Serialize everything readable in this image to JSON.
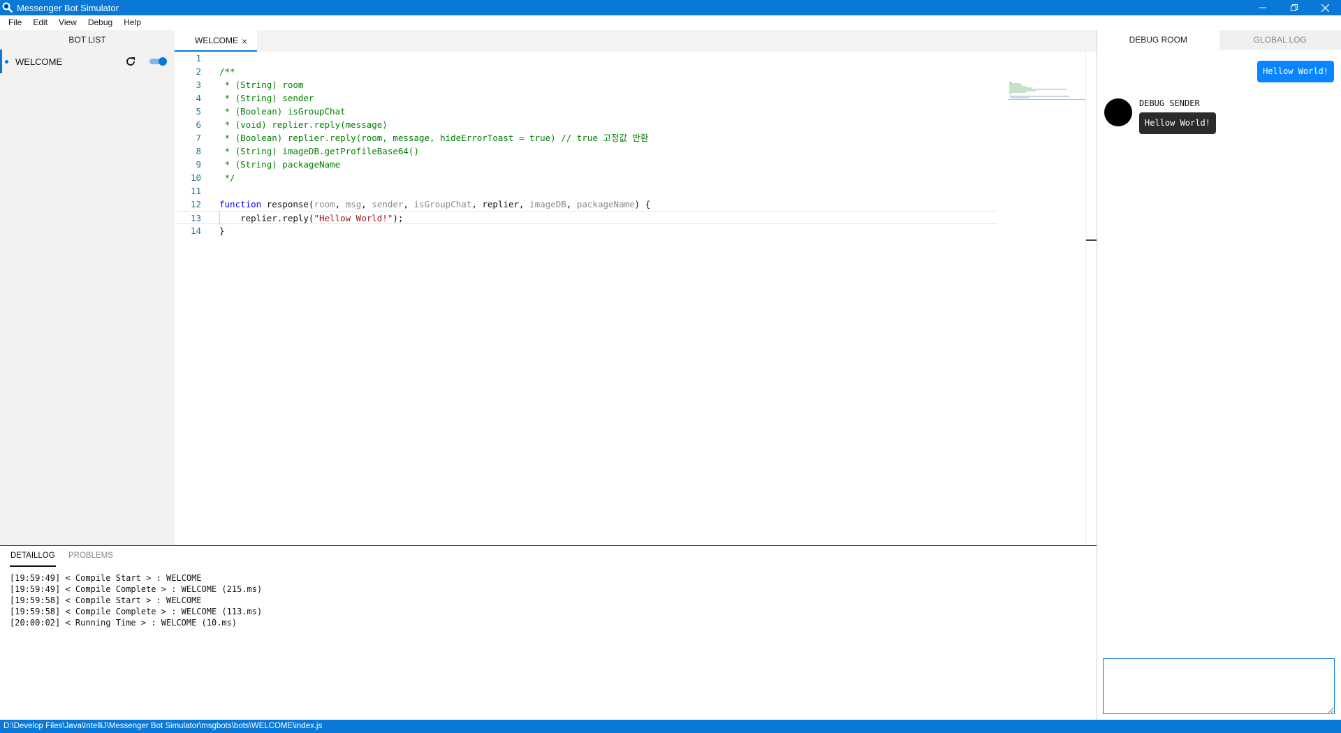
{
  "window": {
    "title": "Messenger Bot Simulator",
    "controls": [
      "minimize",
      "restore",
      "close"
    ]
  },
  "menu": [
    "File",
    "Edit",
    "View",
    "Debug",
    "Help"
  ],
  "sidebar": {
    "header": "BOT LIST",
    "bots": [
      {
        "name": "WELCOME",
        "enabled": true
      }
    ]
  },
  "editor": {
    "tab": {
      "label": "WELCOME",
      "close": "×"
    },
    "lines": [
      {
        "n": "1",
        "parts": []
      },
      {
        "n": "2",
        "parts": [
          {
            "t": "/**",
            "c": "comment"
          }
        ]
      },
      {
        "n": "3",
        "parts": [
          {
            "t": " * (String) room",
            "c": "comment"
          }
        ]
      },
      {
        "n": "4",
        "parts": [
          {
            "t": " * (String) sender",
            "c": "comment"
          }
        ]
      },
      {
        "n": "5",
        "parts": [
          {
            "t": " * (Boolean) isGroupChat",
            "c": "comment"
          }
        ]
      },
      {
        "n": "6",
        "parts": [
          {
            "t": " * (void) replier.reply(message)",
            "c": "comment"
          }
        ]
      },
      {
        "n": "7",
        "parts": [
          {
            "t": " * (Boolean) replier.reply(room, message, hideErrorToast = true) // true 고정값 반환",
            "c": "comment"
          }
        ]
      },
      {
        "n": "8",
        "parts": [
          {
            "t": " * (String) imageDB.getProfileBase64()",
            "c": "comment"
          }
        ]
      },
      {
        "n": "9",
        "parts": [
          {
            "t": " * (String) packageName",
            "c": "comment"
          }
        ]
      },
      {
        "n": "10",
        "parts": [
          {
            "t": " */",
            "c": "comment"
          }
        ]
      },
      {
        "n": "11",
        "parts": []
      },
      {
        "n": "12",
        "parts": [
          {
            "t": "function",
            "c": "kw"
          },
          {
            "t": " response(",
            "c": "plain"
          },
          {
            "t": "room",
            "c": "param"
          },
          {
            "t": ", ",
            "c": "plain"
          },
          {
            "t": "msg",
            "c": "param"
          },
          {
            "t": ", ",
            "c": "plain"
          },
          {
            "t": "sender",
            "c": "param"
          },
          {
            "t": ", ",
            "c": "plain"
          },
          {
            "t": "isGroupChat",
            "c": "param"
          },
          {
            "t": ", replier, ",
            "c": "plain"
          },
          {
            "t": "imageDB",
            "c": "param"
          },
          {
            "t": ", ",
            "c": "plain"
          },
          {
            "t": "packageName",
            "c": "param"
          },
          {
            "t": ") {",
            "c": "plain"
          }
        ]
      },
      {
        "n": "13",
        "current": true,
        "parts": [
          {
            "t": "    replier.reply(",
            "c": "plain"
          },
          {
            "t": "\"Hellow World!\"",
            "c": "str"
          },
          {
            "t": ");",
            "c": "plain"
          }
        ]
      },
      {
        "n": "14",
        "parts": [
          {
            "t": "}",
            "c": "plain"
          }
        ]
      }
    ]
  },
  "debug_panel": {
    "tabs": [
      "DEBUG ROOM",
      "GLOBAL LOG"
    ],
    "active_tab": "DEBUG ROOM",
    "outgoing_message": "Hellow World!",
    "sender_name": "DEBUG SENDER",
    "incoming_message": "Hellow World!",
    "input_value": ""
  },
  "bottom_panel": {
    "tabs": [
      "DETAILLOG",
      "PROBLEMS"
    ],
    "active_tab": "DETAILLOG",
    "log": [
      "[19:59:49] < Compile Start > : WELCOME",
      "[19:59:49] < Compile Complete > : WELCOME (215.ms)",
      "[19:59:58] < Compile Start > : WELCOME",
      "[19:59:58] < Compile Complete > : WELCOME (113.ms)",
      "[20:00:02] < Running Time > : WELCOME (10.ms)"
    ]
  },
  "status_bar": {
    "path": "D:\\Develop Files\\Java\\IntelliJ\\Messenger Bot Simulator\\msgbots\\bots\\WELCOME\\index.js"
  },
  "colors": {
    "accent": "#0a78d7",
    "bubble_out": "#0a84ff",
    "bubble_in": "#2b2b2b",
    "comment": "#008000",
    "keyword": "#0000ff",
    "string": "#a31515",
    "line_number": "#237893"
  }
}
